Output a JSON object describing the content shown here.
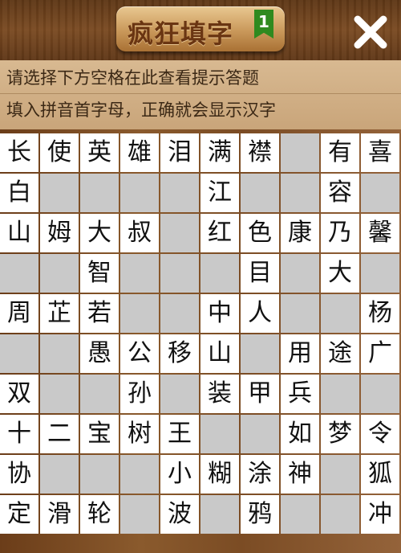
{
  "header": {
    "title": "疯狂填字",
    "level": "1",
    "close_icon": "close-icon"
  },
  "hints": {
    "line1": "请选择下方空格在此查看提示答题",
    "line2": "填入拼音首字母，正确就会显示汉字"
  },
  "colors": {
    "wood": "#7a4a22",
    "hint_bg": "#d8b991",
    "empty_cell": "#c9c9c9",
    "filled_cell": "#ffffff",
    "badge": "#2f8a1f"
  },
  "grid": [
    [
      {
        "c": "长",
        "w": true
      },
      {
        "c": "使",
        "w": true
      },
      {
        "c": "英",
        "w": true
      },
      {
        "c": "雄",
        "w": true
      },
      {
        "c": "泪",
        "w": true
      },
      {
        "c": "满",
        "w": true
      },
      {
        "c": "襟",
        "w": true
      },
      {
        "c": "",
        "w": false
      },
      {
        "c": "有",
        "w": true
      },
      {
        "c": "喜",
        "w": true
      }
    ],
    [
      {
        "c": "白",
        "w": true
      },
      {
        "c": "",
        "w": false
      },
      {
        "c": "",
        "w": false
      },
      {
        "c": "",
        "w": false
      },
      {
        "c": "",
        "w": false
      },
      {
        "c": "江",
        "w": true
      },
      {
        "c": "",
        "w": false
      },
      {
        "c": "",
        "w": false
      },
      {
        "c": "容",
        "w": true
      },
      {
        "c": "",
        "w": false
      }
    ],
    [
      {
        "c": "山",
        "w": true
      },
      {
        "c": "姆",
        "w": true
      },
      {
        "c": "大",
        "w": true
      },
      {
        "c": "叔",
        "w": true
      },
      {
        "c": "",
        "w": false
      },
      {
        "c": "红",
        "w": true
      },
      {
        "c": "色",
        "w": true
      },
      {
        "c": "康",
        "w": true
      },
      {
        "c": "乃",
        "w": true
      },
      {
        "c": "馨",
        "w": true
      }
    ],
    [
      {
        "c": "",
        "w": false
      },
      {
        "c": "",
        "w": false
      },
      {
        "c": "智",
        "w": true
      },
      {
        "c": "",
        "w": false
      },
      {
        "c": "",
        "w": false
      },
      {
        "c": "",
        "w": false
      },
      {
        "c": "目",
        "w": true
      },
      {
        "c": "",
        "w": false
      },
      {
        "c": "大",
        "w": true
      },
      {
        "c": "",
        "w": false
      }
    ],
    [
      {
        "c": "周",
        "w": true
      },
      {
        "c": "芷",
        "w": true
      },
      {
        "c": "若",
        "w": true
      },
      {
        "c": "",
        "w": false
      },
      {
        "c": "",
        "w": false
      },
      {
        "c": "中",
        "w": true
      },
      {
        "c": "人",
        "w": true
      },
      {
        "c": "",
        "w": false
      },
      {
        "c": "",
        "w": false
      },
      {
        "c": "杨",
        "w": true
      }
    ],
    [
      {
        "c": "",
        "w": false
      },
      {
        "c": "",
        "w": false
      },
      {
        "c": "愚",
        "w": true
      },
      {
        "c": "公",
        "w": true
      },
      {
        "c": "移",
        "w": true
      },
      {
        "c": "山",
        "w": true
      },
      {
        "c": "",
        "w": false
      },
      {
        "c": "用",
        "w": true
      },
      {
        "c": "途",
        "w": true
      },
      {
        "c": "广",
        "w": true
      }
    ],
    [
      {
        "c": "双",
        "w": true
      },
      {
        "c": "",
        "w": false
      },
      {
        "c": "",
        "w": false
      },
      {
        "c": "孙",
        "w": true
      },
      {
        "c": "",
        "w": false
      },
      {
        "c": "装",
        "w": true
      },
      {
        "c": "甲",
        "w": true
      },
      {
        "c": "兵",
        "w": true
      },
      {
        "c": "",
        "w": false
      },
      {
        "c": "",
        "w": false
      }
    ],
    [
      {
        "c": "十",
        "w": true
      },
      {
        "c": "二",
        "w": true
      },
      {
        "c": "宝",
        "w": true
      },
      {
        "c": "树",
        "w": true
      },
      {
        "c": "王",
        "w": true
      },
      {
        "c": "",
        "w": false
      },
      {
        "c": "",
        "w": false
      },
      {
        "c": "如",
        "w": true
      },
      {
        "c": "梦",
        "w": true
      },
      {
        "c": "令",
        "w": true
      }
    ],
    [
      {
        "c": "协",
        "w": true
      },
      {
        "c": "",
        "w": false
      },
      {
        "c": "",
        "w": false
      },
      {
        "c": "",
        "w": false
      },
      {
        "c": "小",
        "w": true
      },
      {
        "c": "糊",
        "w": true
      },
      {
        "c": "涂",
        "w": true
      },
      {
        "c": "神",
        "w": true
      },
      {
        "c": "",
        "w": false
      },
      {
        "c": "狐",
        "w": true
      }
    ],
    [
      {
        "c": "定",
        "w": true
      },
      {
        "c": "滑",
        "w": true
      },
      {
        "c": "轮",
        "w": true
      },
      {
        "c": "",
        "w": false
      },
      {
        "c": "波",
        "w": true
      },
      {
        "c": "",
        "w": false
      },
      {
        "c": "鸦",
        "w": true
      },
      {
        "c": "",
        "w": false
      },
      {
        "c": "",
        "w": false
      },
      {
        "c": "冲",
        "w": true
      }
    ]
  ]
}
